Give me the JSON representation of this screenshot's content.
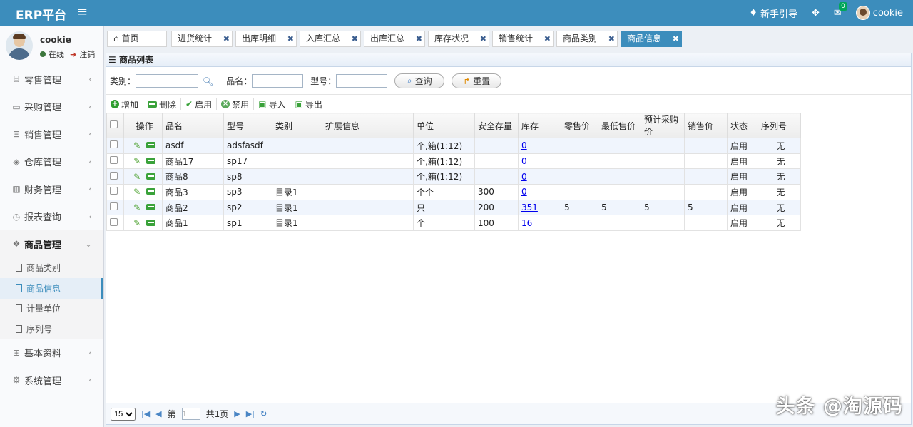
{
  "topbar": {
    "brand": "ERP平台",
    "guide_label": "新手引导",
    "mail_badge": "0",
    "username": "cookie"
  },
  "sidebar": {
    "user": {
      "name": "cookie",
      "status": "在线",
      "logout": "注销"
    },
    "menu": [
      {
        "label": "零售管理"
      },
      {
        "label": "采购管理"
      },
      {
        "label": "销售管理"
      },
      {
        "label": "仓库管理"
      },
      {
        "label": "财务管理"
      },
      {
        "label": "报表查询"
      },
      {
        "label": "商品管理"
      },
      {
        "label": "基本资料"
      },
      {
        "label": "系统管理"
      }
    ],
    "submenu": [
      {
        "label": "商品类别"
      },
      {
        "label": "商品信息"
      },
      {
        "label": "计量单位"
      },
      {
        "label": "序列号"
      }
    ]
  },
  "tabs": [
    {
      "label": "首页"
    },
    {
      "label": "进货统计"
    },
    {
      "label": "出库明细"
    },
    {
      "label": "入库汇总"
    },
    {
      "label": "出库汇总"
    },
    {
      "label": "库存状况"
    },
    {
      "label": "销售统计"
    },
    {
      "label": "商品类别"
    },
    {
      "label": "商品信息"
    }
  ],
  "panel": {
    "title": "商品列表",
    "search": {
      "category_label": "类别：",
      "name_label": "品名：",
      "model_label": "型号：",
      "query_btn": "查询",
      "reset_btn": "重置"
    },
    "toolbar": {
      "add": "增加",
      "delete": "删除",
      "enable": "启用",
      "disable": "禁用",
      "import": "导入",
      "export": "导出"
    },
    "columns": [
      "操作",
      "品名",
      "型号",
      "类别",
      "扩展信息",
      "单位",
      "安全存量",
      "库存",
      "零售价",
      "最低售价",
      "预计采购价",
      "销售价",
      "状态",
      "序列号"
    ],
    "rows": [
      {
        "name": "asdf",
        "model": "adsfasdf",
        "category": "",
        "ext": "",
        "unit": "个,箱(1:12)",
        "safety": "",
        "stock": "0",
        "retail": "",
        "min_price": "",
        "purchase": "",
        "sale": "",
        "status": "启用",
        "serial": "无"
      },
      {
        "name": "商品17",
        "model": "sp17",
        "category": "",
        "ext": "",
        "unit": "个,箱(1:12)",
        "safety": "",
        "stock": "0",
        "retail": "",
        "min_price": "",
        "purchase": "",
        "sale": "",
        "status": "启用",
        "serial": "无"
      },
      {
        "name": "商品8",
        "model": "sp8",
        "category": "",
        "ext": "",
        "unit": "个,箱(1:12)",
        "safety": "",
        "stock": "0",
        "retail": "",
        "min_price": "",
        "purchase": "",
        "sale": "",
        "status": "启用",
        "serial": "无"
      },
      {
        "name": "商品3",
        "model": "sp3",
        "category": "目录1",
        "ext": "",
        "unit": "个个",
        "safety": "300",
        "stock": "0",
        "retail": "",
        "min_price": "",
        "purchase": "",
        "sale": "",
        "status": "启用",
        "serial": "无"
      },
      {
        "name": "商品2",
        "model": "sp2",
        "category": "目录1",
        "ext": "",
        "unit": "只",
        "safety": "200",
        "stock": "351",
        "retail": "5",
        "min_price": "5",
        "purchase": "5",
        "sale": "5",
        "status": "启用",
        "serial": "无"
      },
      {
        "name": "商品1",
        "model": "sp1",
        "category": "目录1",
        "ext": "",
        "unit": "个",
        "safety": "100",
        "stock": "16",
        "retail": "",
        "min_price": "",
        "purchase": "",
        "sale": "",
        "status": "启用",
        "serial": "无"
      }
    ],
    "pager": {
      "page_size": "15",
      "page_prefix": "第",
      "page_value": "1",
      "total_pages": "共1页"
    }
  },
  "watermark": "头条 @淘源码",
  "colors": {
    "brand_blue": "#3c8dbc",
    "sidebar_bg": "#f9fafc",
    "content_bg": "#ecf0f5"
  }
}
